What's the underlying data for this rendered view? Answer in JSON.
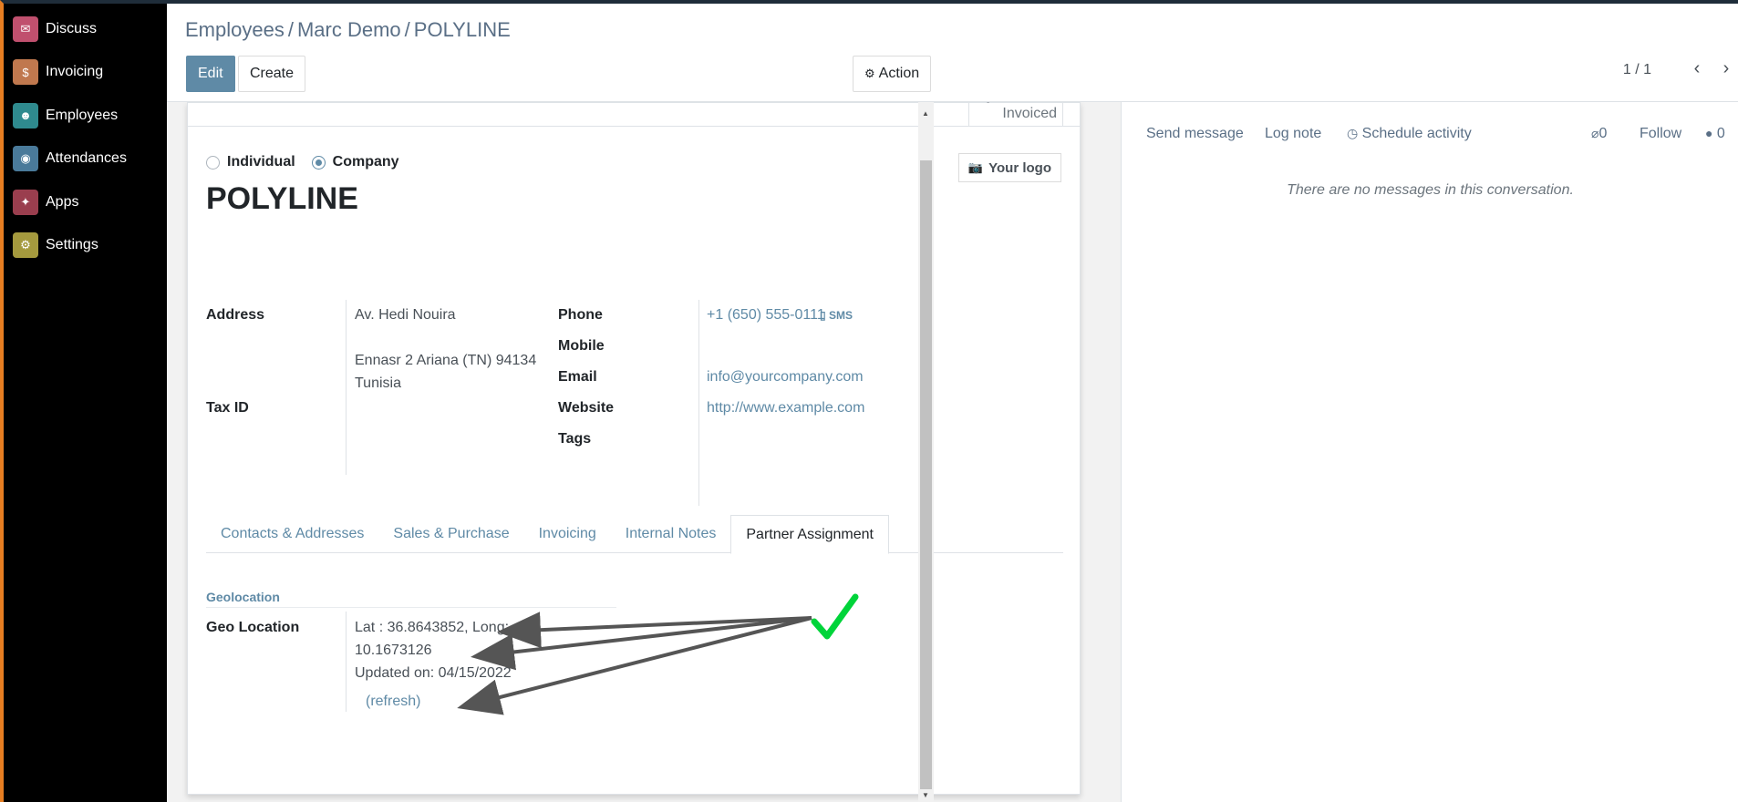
{
  "sidebar": {
    "items": [
      {
        "label": "Discuss",
        "color": "#c0506e",
        "glyph": "✉"
      },
      {
        "label": "Invoicing",
        "color": "#c0784e",
        "glyph": "$"
      },
      {
        "label": "Employees",
        "color": "#2f8a8e",
        "glyph": "☻"
      },
      {
        "label": "Attendances",
        "color": "#4a7a9a",
        "glyph": "◉"
      },
      {
        "label": "Apps",
        "color": "#9a3e4e",
        "glyph": "✦"
      },
      {
        "label": "Settings",
        "color": "#a59a3e",
        "glyph": "⚙"
      }
    ]
  },
  "control": {
    "breadcrumb": [
      "Employees",
      "Marc Demo",
      "POLYLINE"
    ],
    "edit_label": "Edit",
    "create_label": "Create",
    "action_label": "Action",
    "pager": "1 / 1"
  },
  "form": {
    "invoiced_label": "Invoiced",
    "company_type": {
      "individual": "Individual",
      "company": "Company",
      "selected": "company"
    },
    "name": "POLYLINE",
    "logo_label": "Your logo",
    "address_label": "Address",
    "address_line1": "Av. Hedi Nouira",
    "address_line2": "Ennasr 2 Ariana (TN) 94134",
    "address_line3": "Tunisia",
    "tax_id_label": "Tax ID",
    "phone_label": "Phone",
    "phone_value": "+1 (650) 555-0111",
    "sms_label": "SMS",
    "mobile_label": "Mobile",
    "email_label": "Email",
    "email_value": "info@yourcompany.com",
    "website_label": "Website",
    "website_value": "http://www.example.com",
    "tags_label": "Tags",
    "tabs": [
      "Contacts & Addresses",
      "Sales & Purchase",
      "Invoicing",
      "Internal Notes",
      "Partner Assignment"
    ],
    "active_tab": "Partner Assignment",
    "geo_section": "Geolocation",
    "geo_label": "Geo Location",
    "geo_line1": "Lat : 36.8643852, Long:",
    "geo_line2": "10.1673126",
    "geo_updated": "Updated on: 04/15/2022",
    "geo_refresh": "(refresh)"
  },
  "chatter": {
    "send_message": "Send message",
    "log_note": "Log note",
    "schedule_activity": "Schedule activity",
    "attachments": "0",
    "follow": "Follow",
    "followers": "0",
    "empty": "There are no messages in this conversation."
  },
  "colors": {
    "accent": "#5f8aa6",
    "checkmark": "#00d43a",
    "arrow": "#555555"
  }
}
